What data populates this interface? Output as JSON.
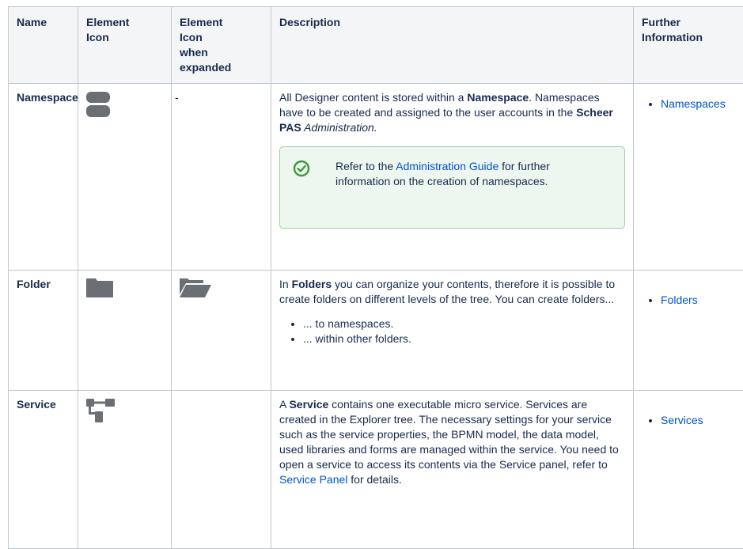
{
  "headers": {
    "name": "Name",
    "icon_line1": "Element",
    "icon_line2": "Icon",
    "expanded_line1": "Element",
    "expanded_line2": "Icon",
    "expanded_line3": "when",
    "expanded_line4": "expanded",
    "description": "Description",
    "further_line1": "Further",
    "further_line2": "Information"
  },
  "rows": {
    "namespace": {
      "name": "Namespace",
      "expanded_icon": "-",
      "desc_1": "All Designer content is stored within a ",
      "desc_bold_1": "Namespace",
      "desc_2": ". Namespaces have to be created and assigned to the user accounts in the ",
      "desc_bold_2": "Scheer PAS",
      "desc_italic_1": " Administration.",
      "panel_text_1": "Refer to the ",
      "panel_link": "Administration Guide",
      "panel_text_2": " for further information on the creation of namespaces.",
      "further_link": "Namespaces",
      "icon": "database-icon"
    },
    "folder": {
      "name": "Folder",
      "desc_1": "In ",
      "desc_bold_1": "Folders",
      "desc_2": " you can organize your contents, therefore it is possible to create folders on different levels of the tree. You can create folders...",
      "bullet_1": "... to namespaces.",
      "bullet_2": "... within other folders.",
      "further_link": "Folders",
      "icon": "folder-icon",
      "expanded_icon": "folder-open-icon"
    },
    "service": {
      "name": "Service",
      "desc_1": "A ",
      "desc_bold_1": "Service",
      "desc_2": " contains one executable micro service. Services are created in the Explorer tree. The necessary settings for your service such as the service properties, the BPMN model,  the data model, used libraries and forms are managed within the service. You need to open a service to access its contents via the Service panel, refer to ",
      "desc_link": "Service Panel",
      "desc_3": " for details.",
      "further_link": "Services",
      "icon": "service-tree-icon"
    }
  },
  "colors": {
    "icon_gray": "#6b6f73",
    "link_blue": "#0052cc",
    "success_green": "#3b9a3b"
  }
}
